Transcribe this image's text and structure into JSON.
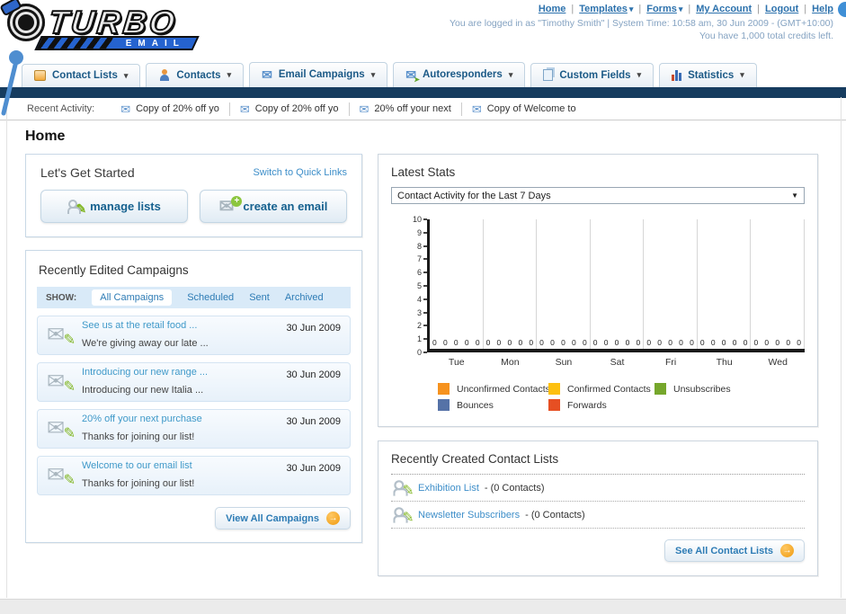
{
  "header": {
    "logo": {
      "title": "TURBO",
      "subtitle": "EMAIL"
    },
    "nav_links": [
      {
        "label": "Home",
        "has_dropdown": false
      },
      {
        "label": "Templates",
        "has_dropdown": true
      },
      {
        "label": "Forms",
        "has_dropdown": true
      },
      {
        "label": "My Account",
        "has_dropdown": false
      },
      {
        "label": "Logout",
        "has_dropdown": false
      },
      {
        "label": "Help",
        "has_dropdown": false
      }
    ],
    "login_status": "You are logged in as \"Timothy Smith\" | System Time: 10:58 am, 30 Jun 2009 - (GMT+10:00)",
    "credits": "You have 1,000 total credits left."
  },
  "tabs": [
    {
      "label": "Contact Lists"
    },
    {
      "label": "Contacts"
    },
    {
      "label": "Email Campaigns"
    },
    {
      "label": "Autoresponders"
    },
    {
      "label": "Custom Fields"
    },
    {
      "label": "Statistics"
    }
  ],
  "recent_activity": {
    "label": "Recent Activity:",
    "items": [
      "Copy of 20% off yo",
      "Copy of 20% off yo",
      "20% off your next",
      "Copy of Welcome to"
    ]
  },
  "page_title": "Home",
  "get_started": {
    "title": "Let's Get Started",
    "switch_link": "Switch to Quick Links",
    "buttons": [
      {
        "label": "manage lists"
      },
      {
        "label": "create an email"
      }
    ]
  },
  "campaigns_panel": {
    "title": "Recently Edited Campaigns",
    "show_label": "SHOW:",
    "filters": [
      "All Campaigns",
      "Scheduled",
      "Sent",
      "Archived"
    ],
    "active_filter": "All Campaigns",
    "items": [
      {
        "title": "See us at the retail food ...",
        "subtitle": "We're giving away our late ...",
        "date": "30 Jun 2009"
      },
      {
        "title": "Introducing our new range ...",
        "subtitle": "Introducing our new Italia ...",
        "date": "30 Jun 2009"
      },
      {
        "title": "20% off your next purchase",
        "subtitle": "Thanks for joining our list!",
        "date": "30 Jun 2009"
      },
      {
        "title": "Welcome to our email list",
        "subtitle": "Thanks for joining our list!",
        "date": "30 Jun 2009"
      }
    ],
    "view_all_label": "View All Campaigns"
  },
  "stats_panel": {
    "title": "Latest Stats",
    "dropdown_value": "Contact Activity for the Last 7 Days"
  },
  "chart_data": {
    "type": "bar",
    "title": "Contact Activity for the Last 7 Days",
    "categories": [
      "Tue",
      "Mon",
      "Sun",
      "Sat",
      "Fri",
      "Thu",
      "Wed"
    ],
    "series": [
      {
        "name": "Unconfirmed Contacts",
        "color": "#f6921e",
        "values": [
          0,
          0,
          0,
          0,
          0,
          0,
          0
        ]
      },
      {
        "name": "Confirmed Contacts",
        "color": "#fdc010",
        "values": [
          0,
          0,
          0,
          0,
          0,
          0,
          0
        ]
      },
      {
        "name": "Unsubscribes",
        "color": "#76a72c",
        "values": [
          0,
          0,
          0,
          0,
          0,
          0,
          0
        ]
      },
      {
        "name": "Bounces",
        "color": "#5572a7",
        "values": [
          0,
          0,
          0,
          0,
          0,
          0,
          0
        ]
      },
      {
        "name": "Forwards",
        "color": "#e64f23",
        "values": [
          0,
          0,
          0,
          0,
          0,
          0,
          0
        ]
      }
    ],
    "ylim": [
      0,
      10
    ],
    "y_tick_step": 1,
    "show_data_labels": true,
    "legend_position": "bottom",
    "grid": "vertical",
    "xlabel": "",
    "ylabel": ""
  },
  "contact_lists_panel": {
    "title": "Recently Created Contact Lists",
    "items": [
      {
        "name": "Exhibition List",
        "suffix": "- (0 Contacts)"
      },
      {
        "name": "Newsletter Subscribers",
        "suffix": "- (0 Contacts)"
      }
    ],
    "see_all_label": "See All Contact Lists"
  }
}
